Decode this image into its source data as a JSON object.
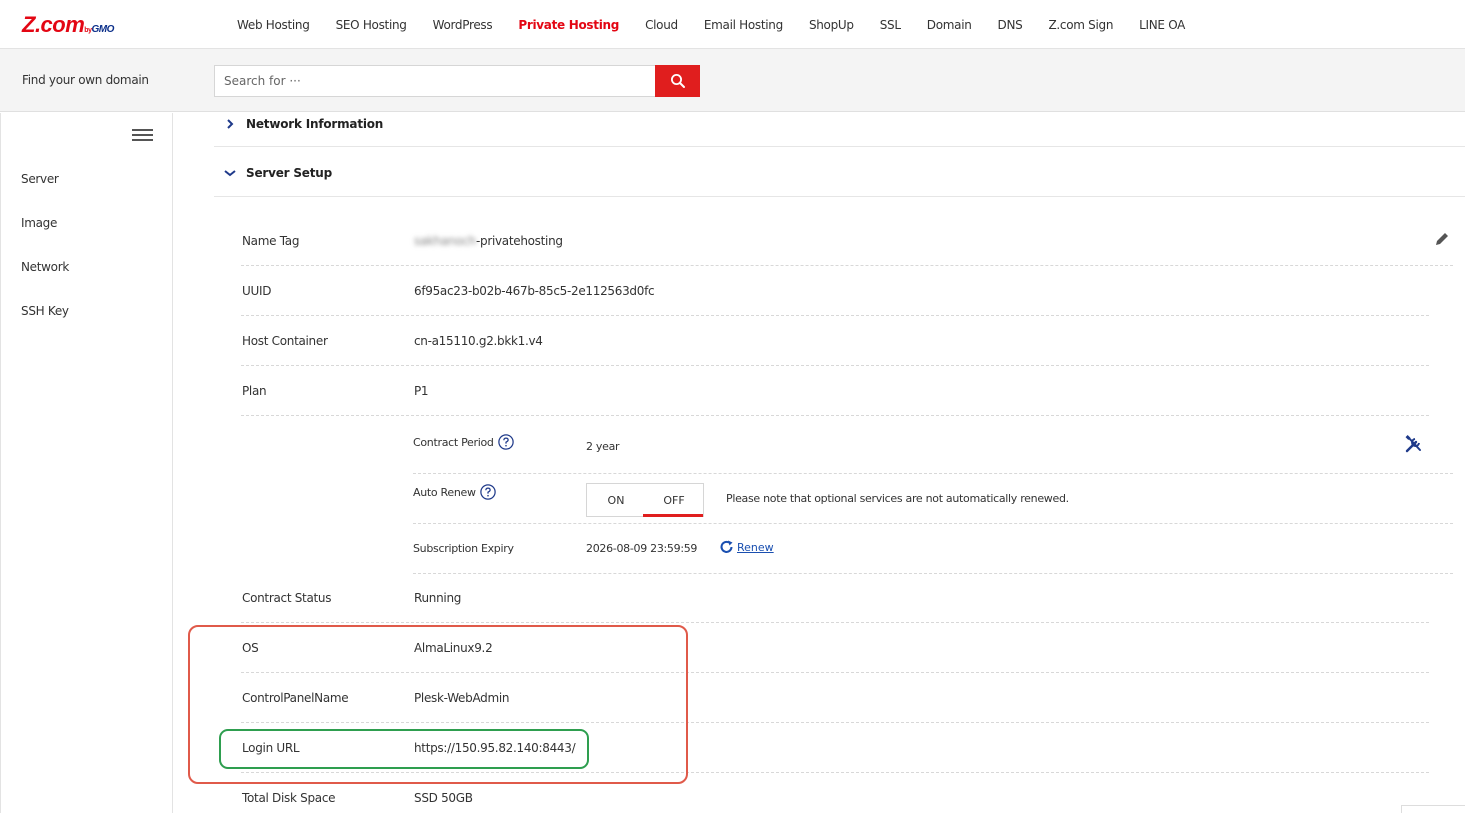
{
  "logo": {
    "brand": "Z.com",
    "by": "by",
    "gmo": "GMO"
  },
  "nav": [
    {
      "label": "Web Hosting",
      "active": false
    },
    {
      "label": "SEO Hosting",
      "active": false
    },
    {
      "label": "WordPress",
      "active": false
    },
    {
      "label": "Private Hosting",
      "active": true
    },
    {
      "label": "Cloud",
      "active": false
    },
    {
      "label": "Email Hosting",
      "active": false
    },
    {
      "label": "ShopUp",
      "active": false
    },
    {
      "label": "SSL",
      "active": false
    },
    {
      "label": "Domain",
      "active": false
    },
    {
      "label": "DNS",
      "active": false
    },
    {
      "label": "Z.com Sign",
      "active": false
    },
    {
      "label": "LINE OA",
      "active": false
    }
  ],
  "search": {
    "label": "Find your own domain",
    "placeholder": "Search for ···",
    "button_icon": "search-icon"
  },
  "sidebar": {
    "menu_icon": "hamburger-icon",
    "items": [
      {
        "label": "Server"
      },
      {
        "label": "Image"
      },
      {
        "label": "Network"
      },
      {
        "label": "SSH Key"
      }
    ]
  },
  "sections": {
    "network": {
      "title": "Network Information",
      "expanded": false
    },
    "server_setup": {
      "title": "Server Setup",
      "expanded": true
    }
  },
  "details": {
    "name_tag": {
      "label": "Name Tag",
      "value_hidden": "sakhanoch",
      "value_suffix": "-privatehosting",
      "edit_icon": "pencil-icon"
    },
    "uuid": {
      "label": "UUID",
      "value": "6f95ac23-b02b-467b-85c5-2e112563d0fc"
    },
    "host_container": {
      "label": "Host Container",
      "value": "cn-a15110.g2.bkk1.v4"
    },
    "plan": {
      "label": "Plan",
      "value": "P1"
    },
    "contract_period": {
      "label": "Contract Period",
      "value": "2 year",
      "tools_icon": "tools-icon"
    },
    "auto_renew": {
      "label": "Auto Renew",
      "on_label": "ON",
      "off_label": "OFF",
      "selected": "OFF",
      "note": "Please note that optional services are not automatically renewed."
    },
    "subscription_expiry": {
      "label": "Subscription Expiry",
      "value": "2026-08-09 23:59:59",
      "renew_label": "Renew"
    },
    "contract_status": {
      "label": "Contract Status",
      "value": "Running"
    },
    "os": {
      "label": "OS",
      "value": "AlmaLinux9.2"
    },
    "control_panel": {
      "label": "ControlPanelName",
      "value": "Plesk-WebAdmin"
    },
    "login_url": {
      "label": "Login URL",
      "value": "https://150.95.82.140:8443/"
    },
    "total_disk": {
      "label": "Total Disk Space",
      "value": "SSD 50GB"
    }
  },
  "colors": {
    "brand_red": "#e30613",
    "highlight_red": "#e05a4a",
    "highlight_green": "#2e9e4f",
    "link_blue": "#1a4fb0"
  }
}
